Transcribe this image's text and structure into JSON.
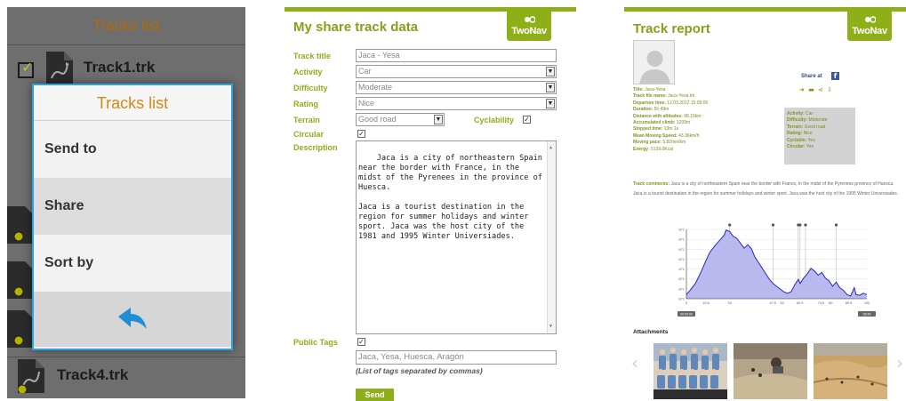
{
  "phone": {
    "title": "Tracks list",
    "tracks": [
      {
        "name": "Track1.trk"
      },
      {
        "name": "Track4.trk"
      }
    ],
    "menu": {
      "title": "Tracks list",
      "items": [
        "Send to",
        "Share",
        "Sort by"
      ],
      "back_icon": "back-arrow-icon"
    },
    "accent": "#2aa3e0"
  },
  "form": {
    "title": "My share track data",
    "logo": "TwoNav",
    "labels": {
      "track_title": "Track title",
      "activity": "Activity",
      "difficulty": "Difficulty",
      "rating": "Rating",
      "terrain": "Terrain",
      "cyclability": "Cyclability",
      "circular": "Circular",
      "description": "Description",
      "public_tags": "Public Tags"
    },
    "values": {
      "track_title": "Jaca - Yesa",
      "activity": "Car",
      "difficulty": "Moderate",
      "rating": "Nice",
      "terrain": "Good road",
      "cyclability": "✓",
      "circular": "✓",
      "public_tags_checked": "✓",
      "tags": "Jaca, Yesa, Huesca, Aragón",
      "description": "Jaca is a city of northeastern Spain near the border with France, in the midst of the Pyrenees in the province of Huesca.\n\nJaca is a tourist destination in the region for summer holidays and winter sport. Jaca was the host city of the 1981 and 1995 Winter Universiades."
    },
    "tags_hint": "(List of tags separated by commas)",
    "send_label": "Send",
    "accent": "#8fae1b"
  },
  "report": {
    "title": "Track report",
    "logo": "TwoNav",
    "share_label": "Share at",
    "stats_left": [
      {
        "k": "Title:",
        "v": "Jaca-Yesa"
      },
      {
        "k": "Track file name:",
        "v": "Jaca-Yesa.trk"
      },
      {
        "k": "Departure time:",
        "v": "12.03.2012 15:09:05"
      },
      {
        "k": "Duration:",
        "v": "5h 49m"
      },
      {
        "k": "Distance with altitudes:",
        "v": "98.15km"
      },
      {
        "k": "Accumulated climb:",
        "v": "1209m"
      },
      {
        "k": "Stopped time:",
        "v": "13m 1s"
      },
      {
        "k": "Mean Moving Speed:",
        "v": "43.36km/h"
      },
      {
        "k": "Moving pace:",
        "v": "5.82min/km"
      },
      {
        "k": "Energy:",
        "v": "5139.0Kcal"
      }
    ],
    "stats_right": [
      {
        "k": "Activity:",
        "v": "Car"
      },
      {
        "k": "Difficulty:",
        "v": "Moderate"
      },
      {
        "k": "Terrain:",
        "v": "Good road"
      },
      {
        "k": "Rating:",
        "v": "Nice"
      },
      {
        "k": "Cyclable:",
        "v": "Yes"
      },
      {
        "k": "Circular:",
        "v": "Yes"
      }
    ],
    "comments_label": "Track comments:",
    "comment1": "Jaca is a city of northeastern Spain near the border with France, in the midst of the Pyrenees province of Huesca.",
    "comment2": "Jaca is a tourist destination in the region for summer holidays and winter sport. Jaca was the host city of the 1995 Winter Universiades.",
    "attachments_label": "Attachments",
    "chart_data": {
      "type": "area",
      "title": "",
      "xlabel": "",
      "ylabel": "",
      "x_ticks": [
        "0",
        "10.8",
        "24",
        "47.9",
        "53",
        "62.9",
        "74.6",
        "80",
        "89.9",
        "100"
      ],
      "x_ends": [
        "00:00:00",
        "05:49"
      ],
      "y_ticks": [
        "871",
        "871",
        "871",
        "871",
        "871",
        "871",
        "871",
        "871"
      ],
      "xlim": [
        0,
        100
      ],
      "series": [
        {
          "values": [
            [
              0,
              0.06
            ],
            [
              2,
              0.12
            ],
            [
              5,
              0.22
            ],
            [
              8,
              0.38
            ],
            [
              11,
              0.56
            ],
            [
              13,
              0.67
            ],
            [
              15,
              0.74
            ],
            [
              17,
              0.8
            ],
            [
              19,
              0.86
            ],
            [
              21,
              0.92
            ],
            [
              22,
              0.99
            ],
            [
              24,
              0.97
            ],
            [
              26,
              0.9
            ],
            [
              28,
              0.87
            ],
            [
              30,
              0.8
            ],
            [
              32,
              0.73
            ],
            [
              34,
              0.78
            ],
            [
              36,
              0.72
            ],
            [
              38,
              0.6
            ],
            [
              40,
              0.52
            ],
            [
              42,
              0.44
            ],
            [
              44,
              0.36
            ],
            [
              46,
              0.28
            ],
            [
              48,
              0.22
            ],
            [
              50,
              0.18
            ],
            [
              52,
              0.14
            ],
            [
              54,
              0.1
            ],
            [
              56,
              0.08
            ],
            [
              58,
              0.1
            ],
            [
              60,
              0.2
            ],
            [
              62,
              0.28
            ],
            [
              63,
              0.22
            ],
            [
              65,
              0.3
            ],
            [
              67,
              0.36
            ],
            [
              69,
              0.44
            ],
            [
              71,
              0.4
            ],
            [
              73,
              0.34
            ],
            [
              75,
              0.38
            ],
            [
              77,
              0.3
            ],
            [
              79,
              0.26
            ],
            [
              81,
              0.18
            ],
            [
              83,
              0.24
            ],
            [
              85,
              0.16
            ],
            [
              87,
              0.12
            ],
            [
              89,
              0.06
            ],
            [
              91,
              0.04
            ],
            [
              92,
              0.1
            ],
            [
              93,
              0.16
            ],
            [
              94,
              0.06
            ],
            [
              96,
              0.05
            ],
            [
              98,
              0.08
            ],
            [
              100,
              0.06
            ]
          ]
        }
      ],
      "markers_at": [
        24,
        48,
        62,
        63,
        66,
        83
      ]
    }
  }
}
